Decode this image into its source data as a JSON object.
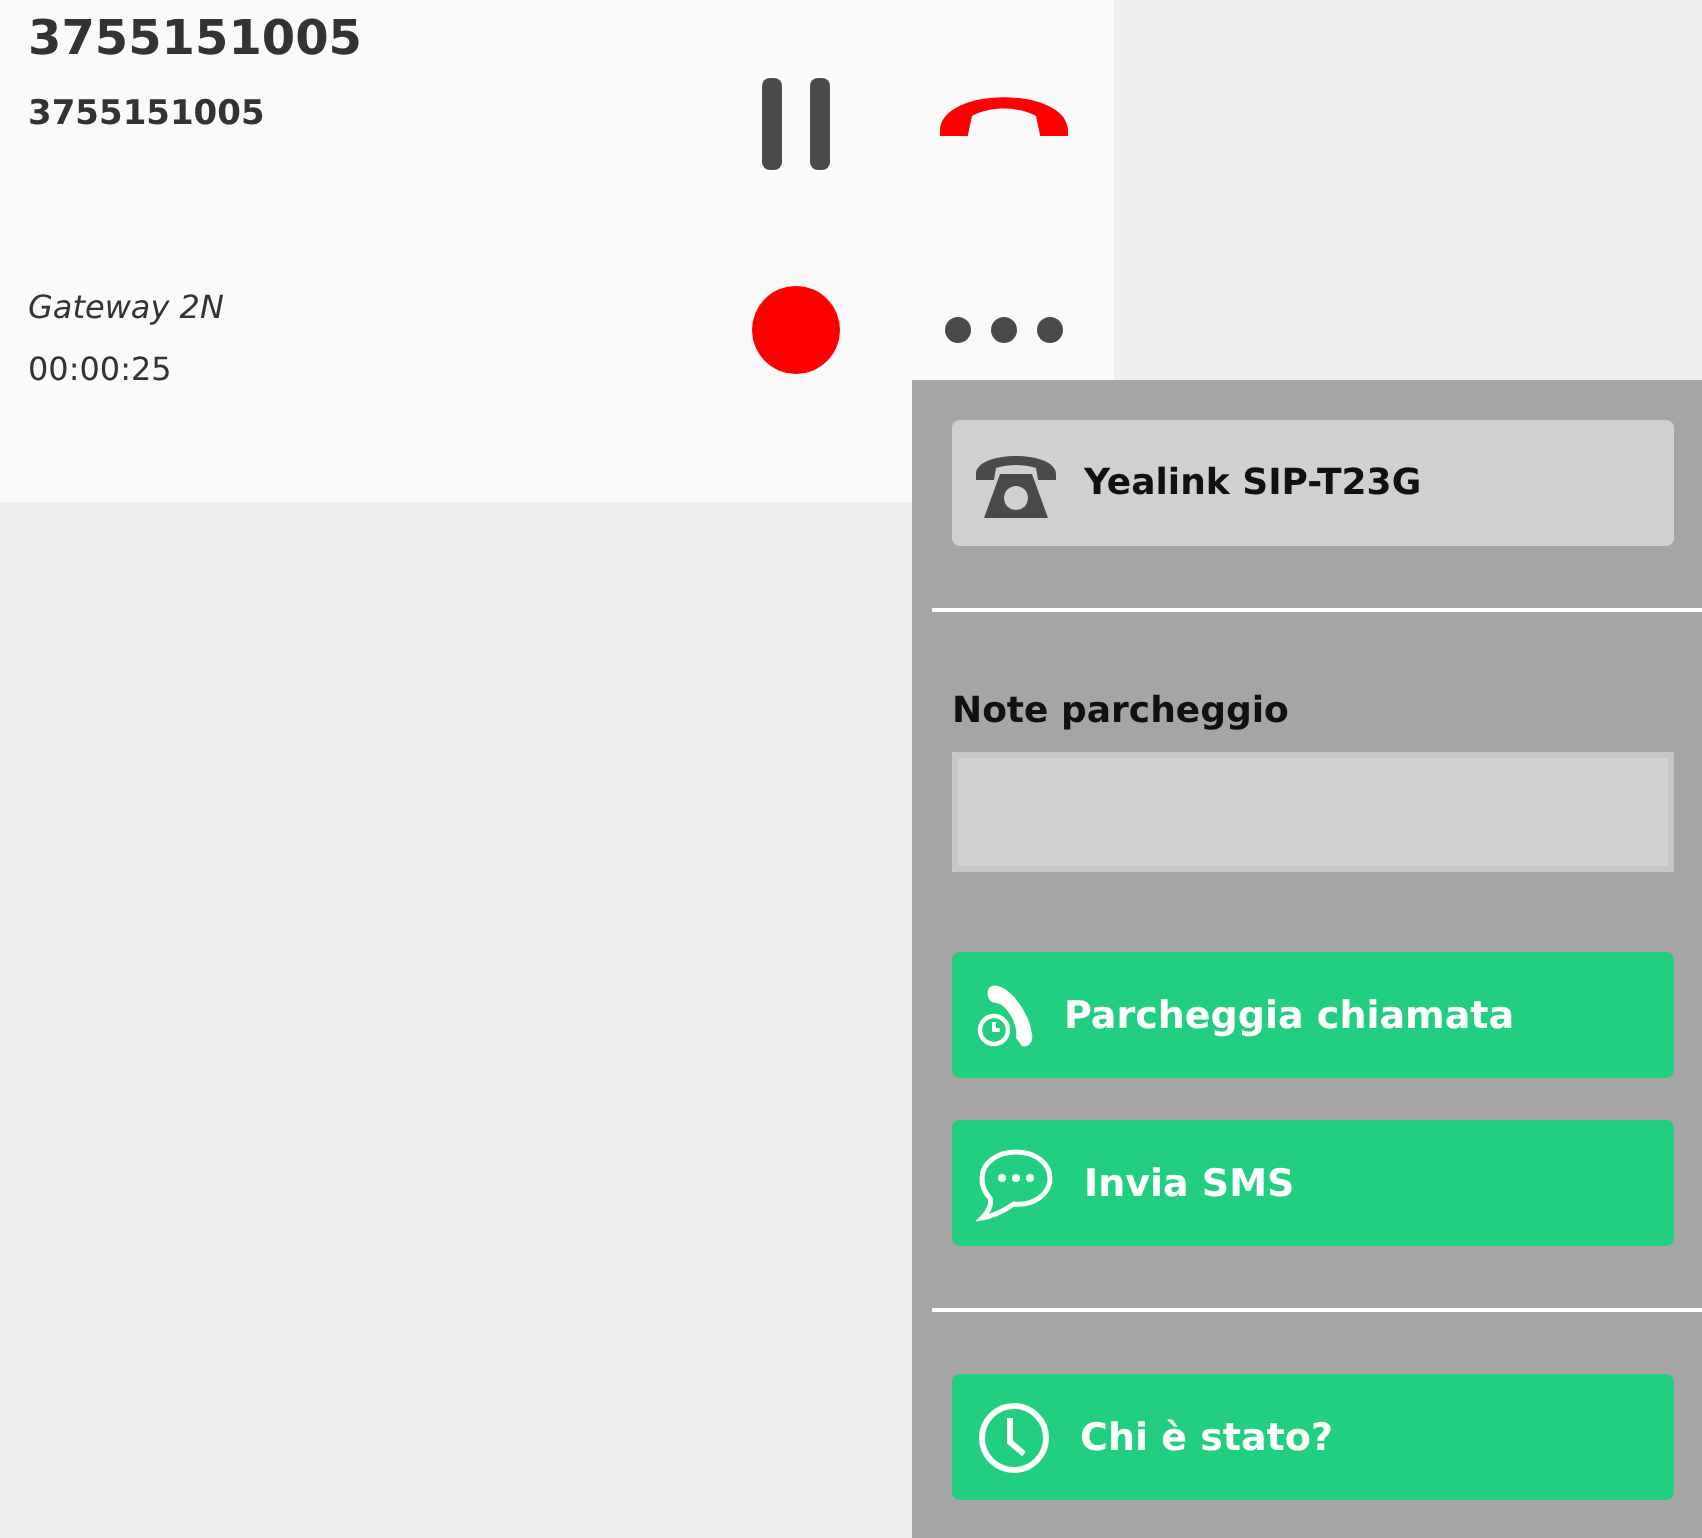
{
  "call": {
    "title": "3755151005",
    "number": "3755151005",
    "line": "Gateway 2N",
    "duration": "00:00:25"
  },
  "menu": {
    "device": "Yealink SIP-T23G",
    "note_label": "Note parcheggio",
    "groups": [
      [
        {
          "kind": "park",
          "label": "Parcheggia chiamata"
        },
        {
          "kind": "sms",
          "label": "Invia SMS"
        }
      ],
      [
        {
          "kind": "history",
          "label": "Chi è stato?"
        }
      ]
    ]
  }
}
